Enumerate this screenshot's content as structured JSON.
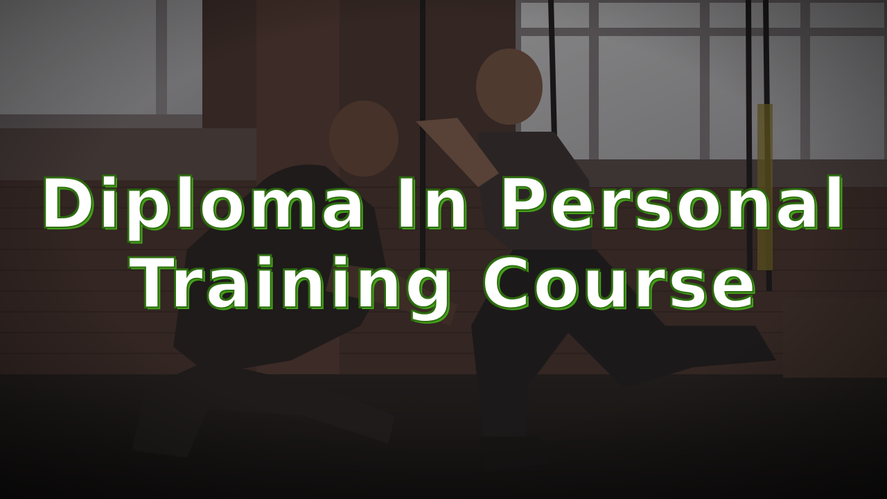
{
  "title": {
    "line1": "Diploma In Personal",
    "line2": "Training Course"
  },
  "colors": {
    "title_text": "#ffffff",
    "title_outline": "#2f6f10",
    "title_shadow": "#43a01a",
    "overlay": "#1a1716"
  },
  "scene": {
    "subjects": [
      "trainer-kneeling",
      "woman-lunging-with-suspension-straps"
    ],
    "setting": "gym-with-brick-wall-and-windows"
  }
}
